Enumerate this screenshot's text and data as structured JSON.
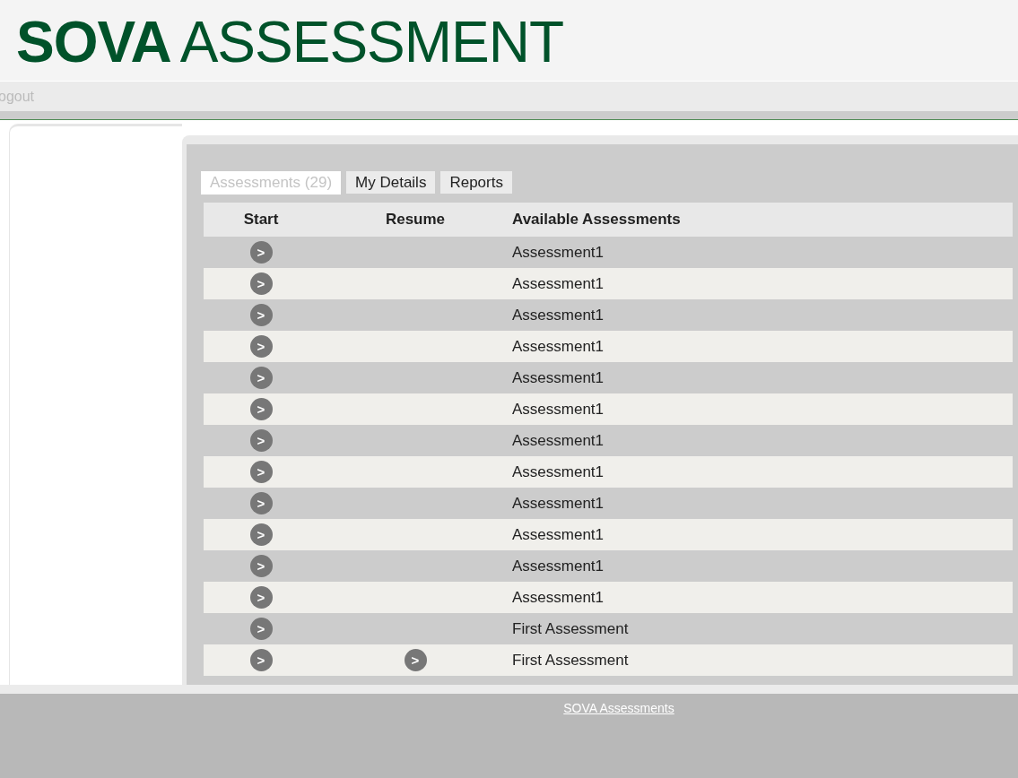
{
  "logo": {
    "bold": "SOVA",
    "light": "ASSESSMENT"
  },
  "nav": {
    "logout": "ogout"
  },
  "tabs": [
    {
      "label": "Assessments (29)",
      "selected": true
    },
    {
      "label": "My Details",
      "selected": false
    },
    {
      "label": "Reports",
      "selected": false
    }
  ],
  "table": {
    "columns": [
      "Start",
      "Resume",
      "Available Assessments"
    ],
    "rows": [
      {
        "name": "Assessment1",
        "start": ">",
        "resume": null
      },
      {
        "name": "Assessment1",
        "start": ">",
        "resume": null
      },
      {
        "name": "Assessment1",
        "start": ">",
        "resume": null
      },
      {
        "name": "Assessment1",
        "start": ">",
        "resume": null
      },
      {
        "name": "Assessment1",
        "start": ">",
        "resume": null
      },
      {
        "name": "Assessment1",
        "start": ">",
        "resume": null
      },
      {
        "name": "Assessment1",
        "start": ">",
        "resume": null
      },
      {
        "name": "Assessment1",
        "start": ">",
        "resume": null
      },
      {
        "name": "Assessment1",
        "start": ">",
        "resume": null
      },
      {
        "name": "Assessment1",
        "start": ">",
        "resume": null
      },
      {
        "name": "Assessment1",
        "start": ">",
        "resume": null
      },
      {
        "name": "Assessment1",
        "start": ">",
        "resume": null
      },
      {
        "name": "First Assessment",
        "start": ">",
        "resume": null
      },
      {
        "name": "First Assessment",
        "start": ">",
        "resume": ">"
      }
    ]
  },
  "footer": {
    "link": "SOVA Assessments"
  }
}
